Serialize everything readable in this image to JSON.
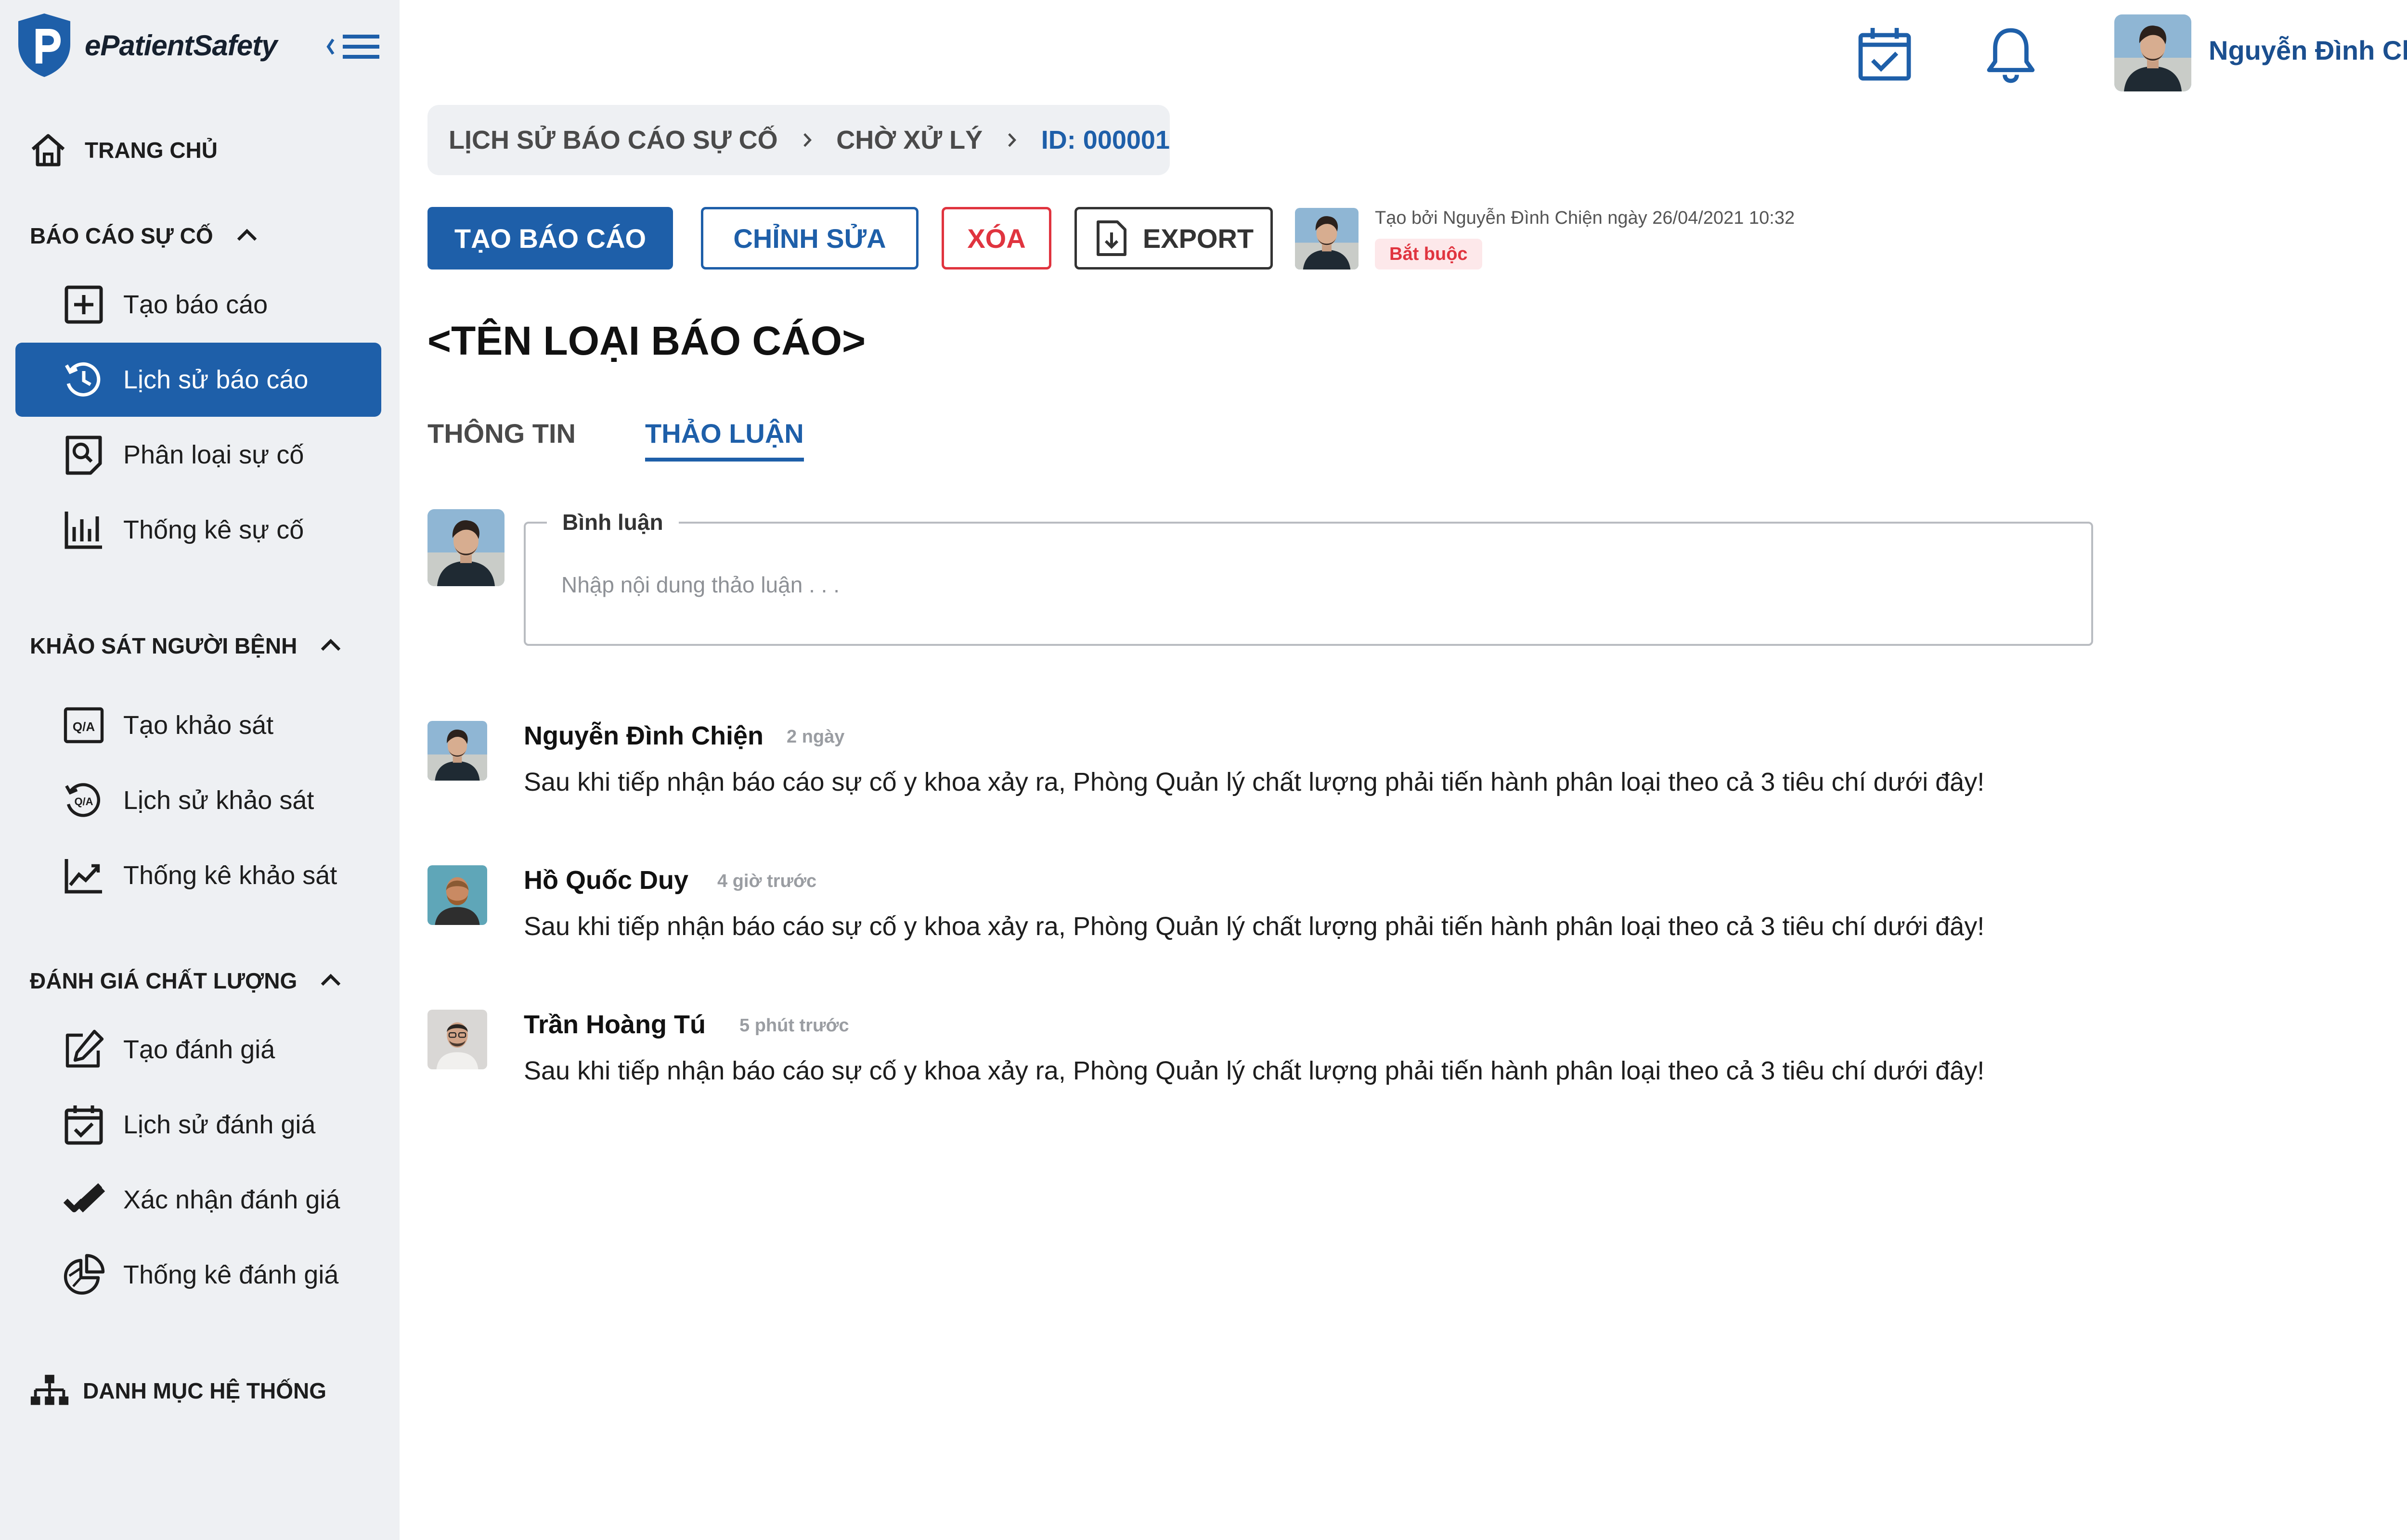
{
  "app": {
    "name": "ePatientSafety"
  },
  "colors": {
    "primary": "#1e5fa9",
    "danger": "#e0343f",
    "sidebar_bg": "#eef0f3",
    "user_name": "#1b4f8f"
  },
  "sidebar": {
    "home": {
      "label": "TRANG CHỦ",
      "icon": "home-icon"
    },
    "sections": [
      {
        "title": "BÁO CÁO SỰ CỐ",
        "items": [
          {
            "label": "Tạo báo cáo",
            "icon": "plus-square-icon"
          },
          {
            "label": "Lịch sử báo cáo",
            "icon": "history-icon",
            "active": true
          },
          {
            "label": "Phân loại sự cố",
            "icon": "classify-icon"
          },
          {
            "label": "Thống kê sự cố",
            "icon": "bar-chart-icon"
          }
        ]
      },
      {
        "title": "KHẢO SÁT NGƯỜI BỆNH",
        "items": [
          {
            "label": "Tạo khảo sát",
            "icon": "qa-icon"
          },
          {
            "label": "Lịch sử khảo sát",
            "icon": "qa-history-icon"
          },
          {
            "label": "Thống kê khảo sát",
            "icon": "line-chart-icon"
          }
        ]
      },
      {
        "title": "ĐÁNH GIÁ CHẤT LƯỢNG",
        "items": [
          {
            "label": "Tạo đánh giá",
            "icon": "edit-icon"
          },
          {
            "label": "Lịch sử đánh giá",
            "icon": "calendar-check-icon"
          },
          {
            "label": "Xác nhận đánh giá",
            "icon": "double-check-icon"
          },
          {
            "label": "Thống kê đánh giá",
            "icon": "pie-chart-icon"
          }
        ]
      }
    ],
    "bottom": {
      "label": "DANH MỤC HỆ THỐNG",
      "icon": "sitemap-icon"
    }
  },
  "header": {
    "user_name": "Nguyễn Đình Chiện",
    "icons": [
      "calendar-check-icon",
      "bell-icon"
    ]
  },
  "breadcrumb": {
    "items": [
      "LỊCH SỬ BÁO CÁO SỰ CỐ",
      "CHỜ XỬ LÝ"
    ],
    "current": "ID: 000001"
  },
  "actions": {
    "create": "TẠO BÁO CÁO",
    "edit": "CHỈNH SỬA",
    "delete": "XÓA",
    "export": "EXPORT"
  },
  "meta": {
    "created_by": "Tạo bởi Nguyễn Đình Chiện ngày 26/04/2021 10:32",
    "badge": "Bắt buộc"
  },
  "report": {
    "title": "<TÊN LOẠI BÁO CÁO>"
  },
  "tabs": {
    "info": "THÔNG TIN",
    "discussion": "THẢO LUẬN",
    "active": "discussion"
  },
  "comment_input": {
    "label": "Bình luận",
    "placeholder": "Nhập nội dung thảo luận . . .",
    "value": ""
  },
  "comments": [
    {
      "author": "Nguyễn Đình Chiện",
      "time": "2 ngày",
      "text": "Sau khi tiếp nhận báo cáo sự cố y khoa xảy ra, Phòng Quản lý chất lượng phải tiến hành phân loại theo cả 3 tiêu chí dưới đây!"
    },
    {
      "author": "Hồ Quốc Duy",
      "time": "4 giờ trước",
      "text": "Sau khi tiếp nhận báo cáo sự cố y khoa xảy ra, Phòng Quản lý chất lượng phải tiến hành phân loại theo cả 3 tiêu chí dưới đây!"
    },
    {
      "author": "Trần Hoàng Tú",
      "time": "5 phút trước",
      "text": "Sau khi tiếp nhận báo cáo sự cố y khoa xảy ra, Phòng Quản lý chất lượng phải tiến hành phân loại theo cả 3 tiêu chí dưới đây!"
    }
  ]
}
